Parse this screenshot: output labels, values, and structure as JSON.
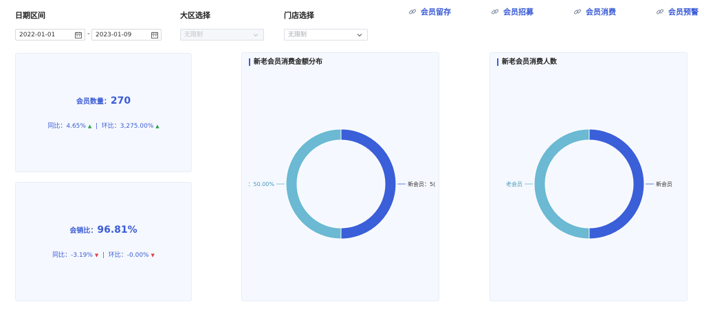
{
  "filters": {
    "date_range_label": "日期区间",
    "start_date": "2022-01-01",
    "end_date": "2023-01-09",
    "separator": "-",
    "region_label": "大区选择",
    "region_value": "无限制",
    "store_label": "门店选择",
    "store_value": "无限制"
  },
  "nav": {
    "links": [
      "会员留存",
      "会员招募",
      "会员消费",
      "会员预警"
    ]
  },
  "cards": {
    "member_count": {
      "label": "会员数量：",
      "value": "270",
      "yoy_label": "同比：",
      "yoy_value": "4.65%",
      "divider": "|",
      "mom_label": "环比：",
      "mom_value": "3,275.00%"
    },
    "sales_ratio": {
      "label": "会销比：",
      "value": "96.81%",
      "yoy_label": "同比：",
      "yoy_value": "-3.19%",
      "divider": "|",
      "mom_label": "环比：",
      "mom_value": "-0.00%"
    }
  },
  "colors": {
    "new_member": "#3a5fd9",
    "old_member": "#6bb9d3",
    "accent": "#3b5cd6"
  },
  "chart_data": [
    {
      "type": "pie",
      "title": "新老会员消费金额分布",
      "series": [
        {
          "name": "新会员",
          "value": 50,
          "label": "新会员：5("
        },
        {
          "name": "老会员",
          "value": 50,
          "label": "：50.00%"
        }
      ]
    },
    {
      "type": "pie",
      "title": "新老会员消费人数",
      "series": [
        {
          "name": "新会员",
          "value": 50,
          "label": "新会员"
        },
        {
          "name": "老会员",
          "value": 50,
          "label": "老会员"
        }
      ]
    }
  ]
}
